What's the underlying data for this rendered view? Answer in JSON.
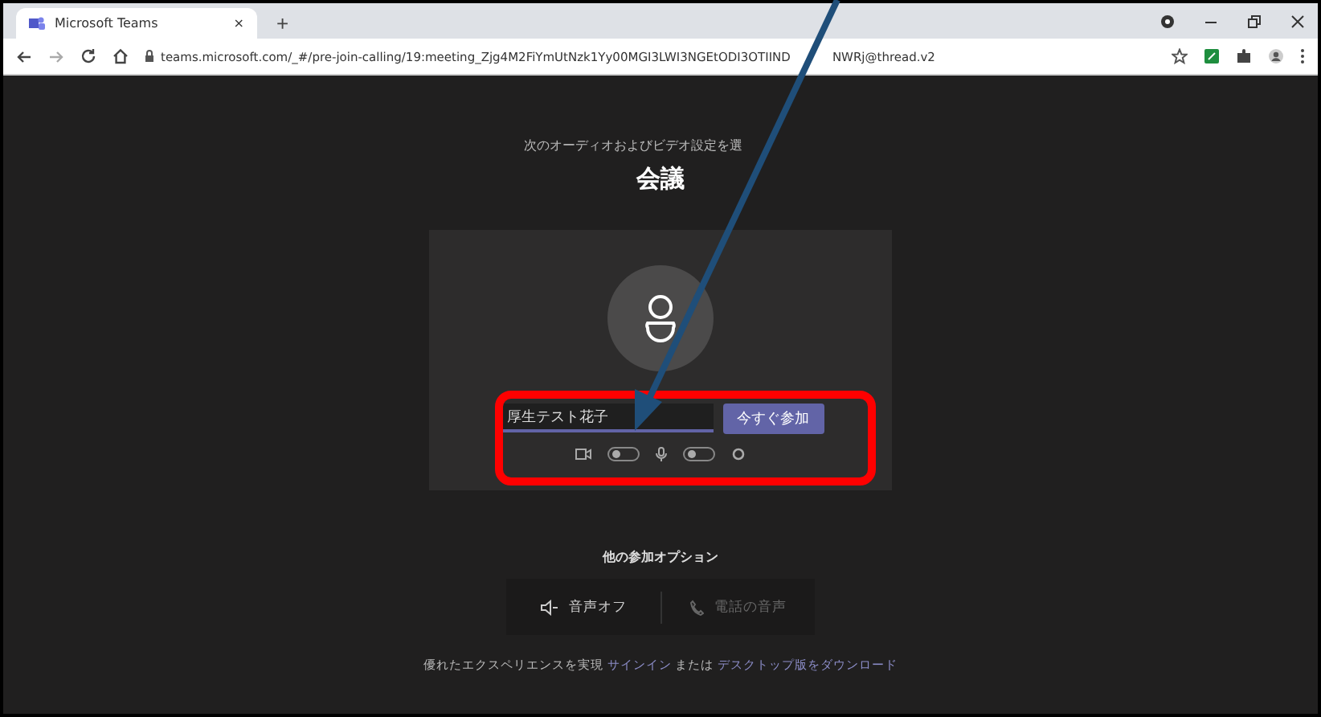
{
  "browser": {
    "tab": {
      "title": "Microsoft Teams",
      "close": "×"
    },
    "new_tab": "+",
    "url_start": "teams.microsoft.com/_#/pre-join-calling/19:meeting_Zjg4M2FiYmUtNzk1Yy00MGI3LWI3NGEtODI3OTIIND",
    "url_end": "NWRj@thread.v2"
  },
  "prejoin": {
    "subtitle": "次のオーディオおよびビデオ設定を選",
    "meeting_title": "会議",
    "name_field": {
      "value": "厚生テスト花子"
    },
    "join_button": "今すぐ参加",
    "toggles": [
      {
        "kind": "camera",
        "on": false
      },
      {
        "kind": "mic",
        "on": false
      }
    ]
  },
  "other_options": {
    "heading": "他の参加オプション",
    "options": [
      {
        "label": "音声オフ",
        "disabled": false,
        "kind": "speaker"
      },
      {
        "label": "電話の音声",
        "disabled": true,
        "kind": "phone"
      }
    ]
  },
  "footer": {
    "text": "優れたエクスペリエンスを実現",
    "link1": "サインイン",
    "middle": "または",
    "link2": "デスクトップ版をダウンロード"
  }
}
